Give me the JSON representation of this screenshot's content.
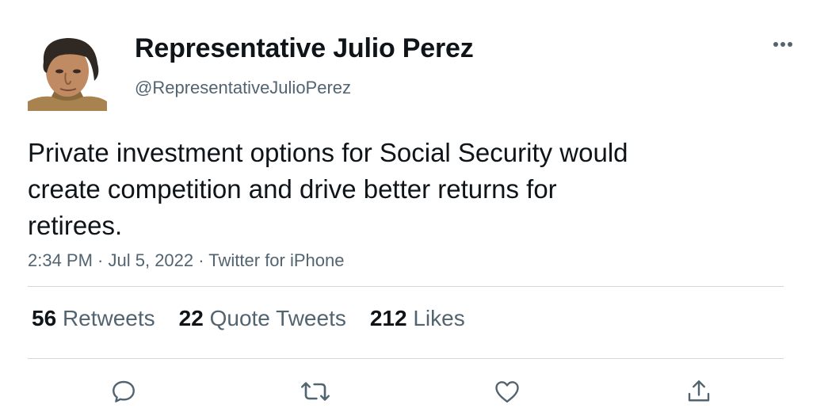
{
  "author": {
    "display_name": "Representative Julio Perez",
    "handle": "@RepresentativeJulioPerez"
  },
  "tweet": {
    "text_lines": [
      "Private investment options for Social Security would",
      "create competition and drive better returns for",
      "retirees."
    ],
    "time": "2:34 PM",
    "date": "Jul 5, 2022",
    "source": "Twitter for iPhone",
    "separator": " · "
  },
  "stats": {
    "retweets": {
      "count": "56",
      "label": "Retweets"
    },
    "quote_tweets": {
      "count": "22",
      "label": "Quote Tweets"
    },
    "likes": {
      "count": "212",
      "label": "Likes"
    }
  },
  "icons": {
    "more": "more-dots-icon",
    "reply": "reply-icon",
    "retweet": "retweet-icon",
    "like": "heart-icon",
    "share": "share-icon"
  },
  "colors": {
    "text_primary": "#0f1419",
    "text_secondary": "#536471",
    "divider": "#cfd9de"
  }
}
